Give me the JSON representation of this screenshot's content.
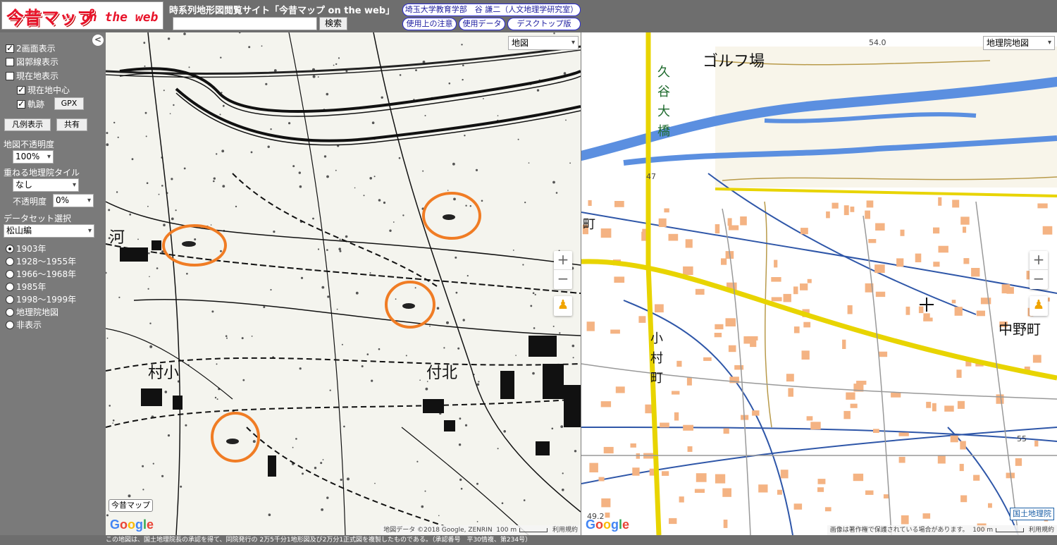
{
  "header": {
    "logo_jp": "今昔マップ",
    "logo_en": "on the web",
    "title": "時系列地形図閲覧サイト「今昔マップ on the web」",
    "search_placeholder": "",
    "search_button": "検索",
    "affiliation": "埼玉大学教育学部　谷 謙二（人文地理学研究室）",
    "notes_button": "使用上の注意",
    "data_button": "使用データ",
    "desktop_button": "デスクトップ版"
  },
  "sidebar": {
    "collapse": "<",
    "dual_view": "2画面表示",
    "grid_lines": "図郭線表示",
    "current_location": "現在地表示",
    "center_current": "現在地中心",
    "track": "軌跡",
    "gpx_button": "GPX",
    "legend_button": "凡例表示",
    "share_button": "共有",
    "opacity_label": "地図不透明度",
    "opacity_value": "100%",
    "overlay_label": "重ねる地理院タイル",
    "overlay_value": "なし",
    "overlay_opacity_label": "不透明度",
    "overlay_opacity_value": "0%",
    "dataset_label": "データセット選択",
    "dataset_value": "松山編",
    "eras": [
      "1903年",
      "1928～1955年",
      "1966～1968年",
      "1985年",
      "1998～1999年",
      "地理院地図",
      "非表示"
    ],
    "selected_era": 0
  },
  "map_left": {
    "type": "地図",
    "labels": {
      "village_a": "村小",
      "village_b": "付北",
      "kawa": "河"
    },
    "konjaku_button": "今昔マップ",
    "attribution": "地図データ ©2018 Google, ZENRIN",
    "scale": "100 m",
    "terms": "利用規約",
    "circle_color": "#f07c24"
  },
  "map_right": {
    "type": "地理院地図",
    "labels": {
      "golf": "ゴルフ場",
      "bridge": "久谷大橋",
      "omura": "小村町",
      "nakano": "中野町",
      "machi": "町",
      "elev_top": "54.0",
      "elev_47": "47",
      "elev_55": "55",
      "elev_492": "49.2"
    },
    "gsi_credit": "国土地理院",
    "attribution": "画像は著作権で保護されている場合があります。",
    "scale": "100 m",
    "terms": "利用規約"
  },
  "footer": {
    "text": "この地図は、国土地理院長の承認を得て、同院発行の 2万5千分1地形図及び2万分1正式図を複製したものである。（承認番号　平30情複、第234号）"
  }
}
